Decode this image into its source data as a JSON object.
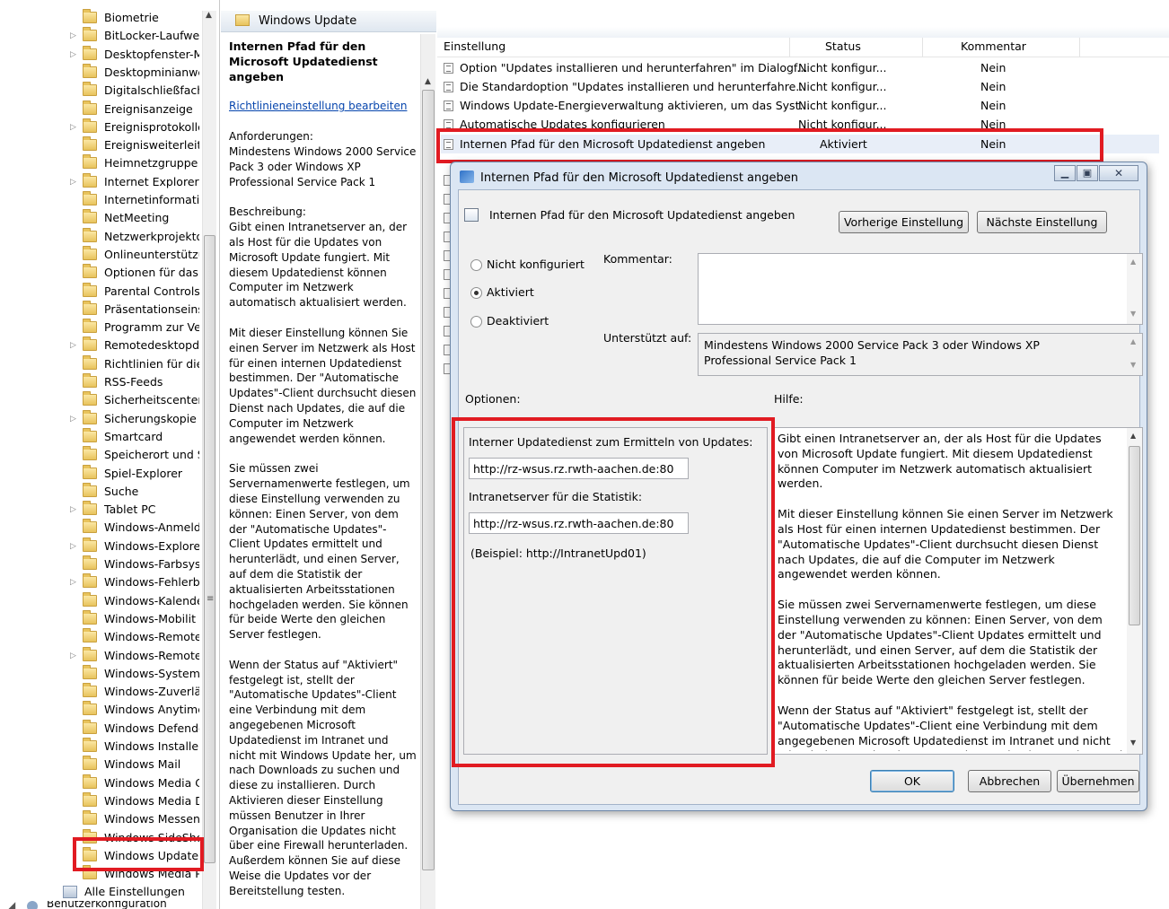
{
  "tree": {
    "items": [
      {
        "label": "Biometrie",
        "arrow": ""
      },
      {
        "label": "BitLocker-Laufwe",
        "arrow": "▷"
      },
      {
        "label": "Desktopfenster-M",
        "arrow": "▷"
      },
      {
        "label": "Desktopminianwe",
        "arrow": ""
      },
      {
        "label": "Digitalschließfach",
        "arrow": ""
      },
      {
        "label": "Ereignisanzeige",
        "arrow": ""
      },
      {
        "label": "Ereignisprotokolle",
        "arrow": "▷"
      },
      {
        "label": "Ereignisweiterleitu",
        "arrow": ""
      },
      {
        "label": "Heimnetzgruppe",
        "arrow": ""
      },
      {
        "label": "Internet Explorer",
        "arrow": "▷"
      },
      {
        "label": "Internetinformatic",
        "arrow": ""
      },
      {
        "label": "NetMeeting",
        "arrow": ""
      },
      {
        "label": "Netzwerkprojekto",
        "arrow": ""
      },
      {
        "label": "Onlineunterstützu",
        "arrow": ""
      },
      {
        "label": "Optionen für das I",
        "arrow": ""
      },
      {
        "label": "Parental Controls",
        "arrow": ""
      },
      {
        "label": "Präsentationseinst",
        "arrow": ""
      },
      {
        "label": "Programm zur Ve",
        "arrow": ""
      },
      {
        "label": "Remotedesktopdi",
        "arrow": "▷"
      },
      {
        "label": "Richtlinien für die",
        "arrow": ""
      },
      {
        "label": "RSS-Feeds",
        "arrow": ""
      },
      {
        "label": "Sicherheitscenter",
        "arrow": ""
      },
      {
        "label": "Sicherungskopie",
        "arrow": "▷"
      },
      {
        "label": "Smartcard",
        "arrow": ""
      },
      {
        "label": "Speicherort und S",
        "arrow": ""
      },
      {
        "label": "Spiel-Explorer",
        "arrow": ""
      },
      {
        "label": "Suche",
        "arrow": ""
      },
      {
        "label": "Tablet PC",
        "arrow": "▷"
      },
      {
        "label": "Windows-Anmeld",
        "arrow": ""
      },
      {
        "label": "Windows-Explorer",
        "arrow": "▷"
      },
      {
        "label": "Windows-Farbsys",
        "arrow": ""
      },
      {
        "label": "Windows-Fehlerb",
        "arrow": "▷"
      },
      {
        "label": "Windows-Kalende",
        "arrow": ""
      },
      {
        "label": "Windows-Mobilit",
        "arrow": ""
      },
      {
        "label": "Windows-Remote",
        "arrow": ""
      },
      {
        "label": "Windows-Remote",
        "arrow": "▷"
      },
      {
        "label": "Windows-Systemi",
        "arrow": ""
      },
      {
        "label": "Windows-Zuverlä",
        "arrow": ""
      },
      {
        "label": "Windows Anytime",
        "arrow": ""
      },
      {
        "label": "Windows Defende",
        "arrow": ""
      },
      {
        "label": "Windows Installer",
        "arrow": ""
      },
      {
        "label": "Windows Mail",
        "arrow": ""
      },
      {
        "label": "Windows Media C",
        "arrow": ""
      },
      {
        "label": "Windows Media D",
        "arrow": ""
      },
      {
        "label": "Windows Messen",
        "arrow": ""
      },
      {
        "label": "Windows SideSho",
        "arrow": ""
      },
      {
        "label": "Windows Update",
        "arrow": ""
      },
      {
        "label": "Windows Media P",
        "arrow": ""
      }
    ],
    "all_settings": "Alle Einstellungen",
    "user_config": "Benutzerkonfiguration"
  },
  "desc": {
    "header": "Windows Update",
    "title": "Internen Pfad für den Microsoft Updatedienst angeben",
    "edit_link": "Richtlinieneinstellung bearbeiten",
    "requirements_label": "Anforderungen:",
    "requirements": "Mindestens Windows 2000 Service Pack 3 oder Windows XP Professional Service Pack 1",
    "description_label": "Beschreibung:",
    "p1": "Gibt einen Intranetserver an, der als Host für die Updates von Microsoft Update fungiert. Mit diesem Updatedienst können Computer im Netzwerk automatisch aktualisiert werden.",
    "p2": "Mit dieser Einstellung können Sie einen Server im Netzwerk als Host für einen internen Updatedienst bestimmen. Der \"Automatische Updates\"-Client durchsucht diesen Dienst nach Updates, die auf die Computer im Netzwerk angewendet werden können.",
    "p3": "Sie müssen zwei Servernamenwerte festlegen, um diese Einstellung verwenden zu können: Einen Server, von dem der \"Automatische Updates\"-Client Updates ermittelt und herunterlädt, und einen Server, auf dem die Statistik der aktualisierten Arbeitsstationen hochgeladen werden. Sie können für beide Werte den gleichen Server festlegen.",
    "p4": "Wenn der Status auf \"Aktiviert\" festgelegt ist, stellt der \"Automatische Updates\"-Client eine Verbindung mit dem angegebenen Microsoft Updatedienst im Intranet und nicht mit Windows Update her, um nach Downloads zu suchen und diese zu installieren. Durch Aktivieren dieser Einstellung müssen Benutzer in Ihrer Organisation die Updates nicht über eine Firewall herunterladen. Außerdem können Sie auf diese Weise die Updates vor der Bereitstellung testen."
  },
  "list": {
    "columns": {
      "setting": "Einstellung",
      "status": "Status",
      "comment": "Kommentar"
    },
    "rows": [
      {
        "name": "Option \"Updates installieren und herunterfahren\" im Dialogf...",
        "status": "Nicht konfigur...",
        "comment": "Nein"
      },
      {
        "name": "Die Standardoption \"Updates installieren und herunterfahre...",
        "status": "Nicht konfigur...",
        "comment": "Nein"
      },
      {
        "name": "Windows Update-Energieverwaltung aktivieren, um das Syst...",
        "status": "Nicht konfigur...",
        "comment": "Nein"
      },
      {
        "name": "Automatische Updates konfigurieren",
        "status": "Nicht konfigur...",
        "comment": "Nein"
      },
      {
        "name": "Internen Pfad für den Microsoft Updatedienst angeben",
        "status": "Aktiviert",
        "comment": "Nein"
      }
    ]
  },
  "dialog": {
    "title": "Internen Pfad für den Microsoft Updatedienst angeben",
    "setting_name": "Internen Pfad für den Microsoft Updatedienst angeben",
    "prev_button": "Vorherige Einstellung",
    "next_button": "Nächste Einstellung",
    "radio_not_configured": "Nicht konfiguriert",
    "radio_enabled": "Aktiviert",
    "radio_disabled": "Deaktiviert",
    "selected_state": "Aktiviert",
    "comment_label": "Kommentar:",
    "comment_value": "",
    "supported_label": "Unterstützt auf:",
    "supported_value": "Mindestens Windows 2000 Service Pack 3 oder Windows XP Professional Service Pack 1",
    "options_label": "Optionen:",
    "help_label": "Hilfe:",
    "update_service_label": "Interner Updatedienst zum Ermitteln von Updates:",
    "update_service_value": "http://rz-wsus.rz.rwth-aachen.de:80",
    "stats_server_label": "Intranetserver für die Statistik:",
    "stats_server_value": "http://rz-wsus.rz.rwth-aachen.de:80",
    "example": "(Beispiel: http://IntranetUpd01)",
    "help_p1": "Gibt einen Intranetserver an, der als Host für die Updates von Microsoft Update fungiert. Mit diesem Updatedienst können Computer im Netzwerk automatisch aktualisiert werden.",
    "help_p2": "Mit dieser Einstellung können Sie einen Server im Netzwerk als Host für einen internen Updatedienst bestimmen. Der \"Automatische Updates\"-Client durchsucht diesen Dienst nach Updates, die auf die Computer im Netzwerk angewendet werden können.",
    "help_p3": "Sie müssen zwei Servernamenwerte festlegen, um diese Einstellung verwenden zu können: Einen Server, von dem der \"Automatische Updates\"-Client Updates ermittelt und herunterlädt, und einen Server, auf dem die Statistik der aktualisierten Arbeitsstationen hochgeladen werden. Sie können für beide Werte den gleichen Server festlegen.",
    "help_p4": "Wenn der Status auf \"Aktiviert\" festgelegt ist, stellt der \"Automatische Updates\"-Client eine Verbindung mit dem angegebenen Microsoft Updatedienst im Intranet und nicht mit Windows Update her, um nach Downloads zu suchen und diese",
    "ok_button": "OK",
    "cancel_button": "Abbrechen",
    "apply_button": "Übernehmen"
  },
  "colors": {
    "highlight": "#e11b22",
    "link": "#0645ad"
  }
}
